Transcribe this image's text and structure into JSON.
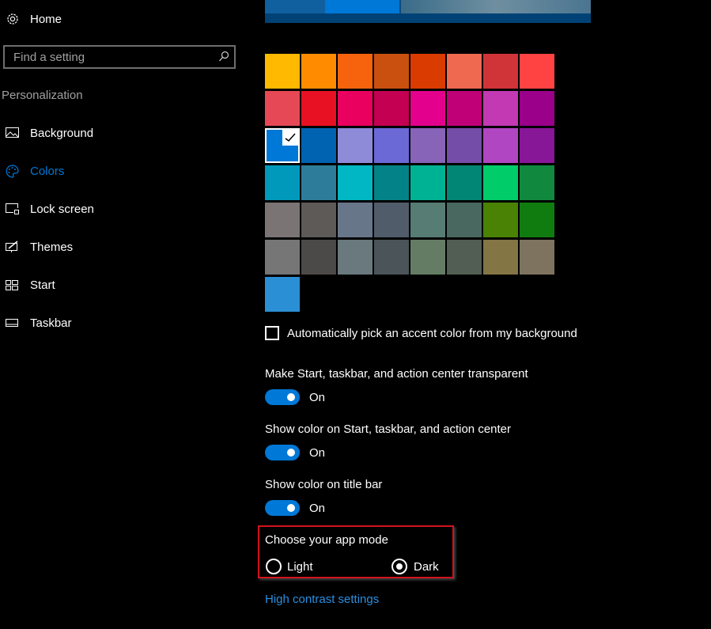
{
  "sidebar": {
    "home_label": "Home",
    "search_placeholder": "Find a setting",
    "section_title": "Personalization",
    "items": [
      {
        "label": "Background",
        "icon": "picture-icon"
      },
      {
        "label": "Colors",
        "icon": "palette-icon",
        "active": true
      },
      {
        "label": "Lock screen",
        "icon": "lock-screen-icon"
      },
      {
        "label": "Themes",
        "icon": "themes-icon"
      },
      {
        "label": "Start",
        "icon": "start-icon"
      },
      {
        "label": "Taskbar",
        "icon": "taskbar-icon"
      }
    ]
  },
  "colors": {
    "accent": "#0078d7",
    "selected": "#0078D7",
    "swatches": [
      [
        "#FFB900",
        "#FF8C00",
        "#F7630C",
        "#CA5010",
        "#DA3B01",
        "#EF6950",
        "#D13438",
        "#FF4343"
      ],
      [
        "#E74856",
        "#E81123",
        "#EA005E",
        "#C30052",
        "#E3008C",
        "#BF0077",
        "#C239B3",
        "#9A0089"
      ],
      [
        "#0078D7",
        "#0063B1",
        "#8E8CD8",
        "#6B69D6",
        "#8764B8",
        "#744DA9",
        "#B146C2",
        "#881798"
      ],
      [
        "#0099BC",
        "#2D7D9A",
        "#00B7C3",
        "#038387",
        "#00B294",
        "#018574",
        "#00CC6A",
        "#10893E"
      ],
      [
        "#7A7574",
        "#5D5A58",
        "#68768A",
        "#515C6B",
        "#567C73",
        "#486860",
        "#498205",
        "#107C10"
      ],
      [
        "#767676",
        "#4C4A48",
        "#69797E",
        "#4A5459",
        "#647C64",
        "#525E54",
        "#847545",
        "#7E735F"
      ],
      [
        "#2B8FD6"
      ]
    ]
  },
  "main": {
    "auto_pick_label": "Automatically pick an accent color from my background",
    "auto_pick_checked": false,
    "transparent_label": "Make Start, taskbar, and action center transparent",
    "transparent_state": "On",
    "show_color_start_label": "Show color on Start, taskbar, and action center",
    "show_color_start_state": "On",
    "show_color_title_label": "Show color on title bar",
    "show_color_title_state": "On",
    "app_mode_label": "Choose your app mode",
    "app_mode_light": "Light",
    "app_mode_dark": "Dark",
    "app_mode_selected": "Dark",
    "high_contrast_link": "High contrast settings"
  }
}
